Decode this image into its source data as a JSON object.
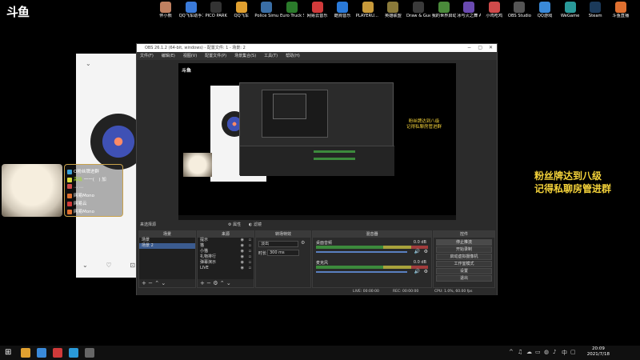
{
  "logo": "斗鱼",
  "desktop_icons": [
    {
      "label": "怀小熊",
      "color": "#c08060"
    },
    {
      "label": "QQ飞车助手工具",
      "color": "#3a7ad9"
    },
    {
      "label": "PICO PARK",
      "color": "#333333"
    },
    {
      "label": "QQ飞车",
      "color": "#e0a030"
    },
    {
      "label": "Police Simulat...",
      "color": "#3a6ea5"
    },
    {
      "label": "Euro Truck Simulator 2",
      "color": "#2a7a2a"
    },
    {
      "label": "网易云音乐",
      "color": "#d03a3a"
    },
    {
      "label": "酷狗音乐",
      "color": "#2a7ad9"
    },
    {
      "label": "PLAYERU... BATTLEGR...",
      "color": "#c89a3a"
    },
    {
      "label": "英雄联盟",
      "color": "#8a7a3a"
    },
    {
      "label": "Draw & Guess",
      "color": "#3a3a3a"
    },
    {
      "label": "我的世界启动器",
      "color": "#4a8a3a"
    },
    {
      "label": "冰与火之舞 A Dance of F...",
      "color": "#6a4ab0"
    },
    {
      "label": "小鸡吃鸡",
      "color": "#d04a4a"
    },
    {
      "label": "OBS Studio",
      "color": "#555555"
    },
    {
      "label": "QQ游戏",
      "color": "#3a8ad9"
    },
    {
      "label": "WeGame",
      "color": "#2a9a9a"
    },
    {
      "label": "Steam",
      "color": "#1b3a5a"
    },
    {
      "label": "斗鱼直播",
      "color": "#e07030"
    }
  ],
  "chat": {
    "lines": [
      {
        "user": "",
        "text": "O粉丝牌进群",
        "color": "#3aa0d9"
      },
      {
        "user": "高级",
        "text": "一一(　) 加",
        "color": "#d9d93a"
      },
      {
        "user": "",
        "text": "...  ...",
        "color": "#d04a4a"
      },
      {
        "user": "",
        "text": "网易Mono",
        "color": "#e07030"
      },
      {
        "user": "",
        "text": "网易云",
        "color": "#d03a3a"
      },
      {
        "user": "",
        "text": "网易Mono",
        "color": "#e07030"
      }
    ]
  },
  "obs": {
    "title": "OBS 26.1.2 (64-bit, windows) - 配置文件: 1 - 场景: 2",
    "menu": [
      "文件(F)",
      "编辑(E)",
      "视图(V)",
      "配置文件(P)",
      "场景集合(S)",
      "工具(T)",
      "帮助(H)"
    ],
    "preview_text_1": "粉丝牌达到八级",
    "preview_text_2": "记得私聊房管进群",
    "preview_logo": "斗鱼",
    "status_left": "来选择源",
    "status_props": "属性",
    "status_filters": "滤镜",
    "docks": {
      "scenes": {
        "title": "场景",
        "items": [
          "场景",
          "场景 2"
        ],
        "selected": 1
      },
      "sources": {
        "title": "来源",
        "items": [
          "提示",
          "猫",
          "小猫",
          "礼物排行",
          "弹幕演示",
          "LIVE"
        ]
      },
      "transitions": {
        "title": "转场特效",
        "type": "淡出",
        "duration_label": "时长",
        "duration": "300 ms"
      },
      "mixer": {
        "title": "混音器",
        "tracks": [
          {
            "name": "桌面音频",
            "db": "0.0 dB"
          },
          {
            "name": "麦克风",
            "db": "0.0 dB"
          }
        ]
      },
      "controls": {
        "title": "控件",
        "buttons": [
          "停止推流",
          "开始录制",
          "启动虚拟摄像机",
          "工作室模式",
          "设置",
          "退出"
        ]
      }
    },
    "footer": {
      "live": "LIVE: 00:00:00",
      "rec": "REC: 00:00:00",
      "cpu": "CPU: 1.0%, 60.00 fps"
    }
  },
  "overlay": {
    "line1": "粉丝牌达到八级",
    "line2": "记得私聊房管进群"
  },
  "taskbar": {
    "time": "20:09",
    "date": "2021/7/18",
    "apps": [
      {
        "name": "start",
        "color": "#ffffff"
      },
      {
        "name": "chrome",
        "color": "#e0a030"
      },
      {
        "name": "app2",
        "color": "#3a8ad9"
      },
      {
        "name": "netease",
        "color": "#d03a3a"
      },
      {
        "name": "app4",
        "color": "#2a9ad9"
      },
      {
        "name": "obs",
        "color": "#666666"
      }
    ],
    "tray": [
      "^",
      "♫",
      "☁",
      "▭",
      "◍",
      "♪",
      "中",
      "▢"
    ]
  }
}
